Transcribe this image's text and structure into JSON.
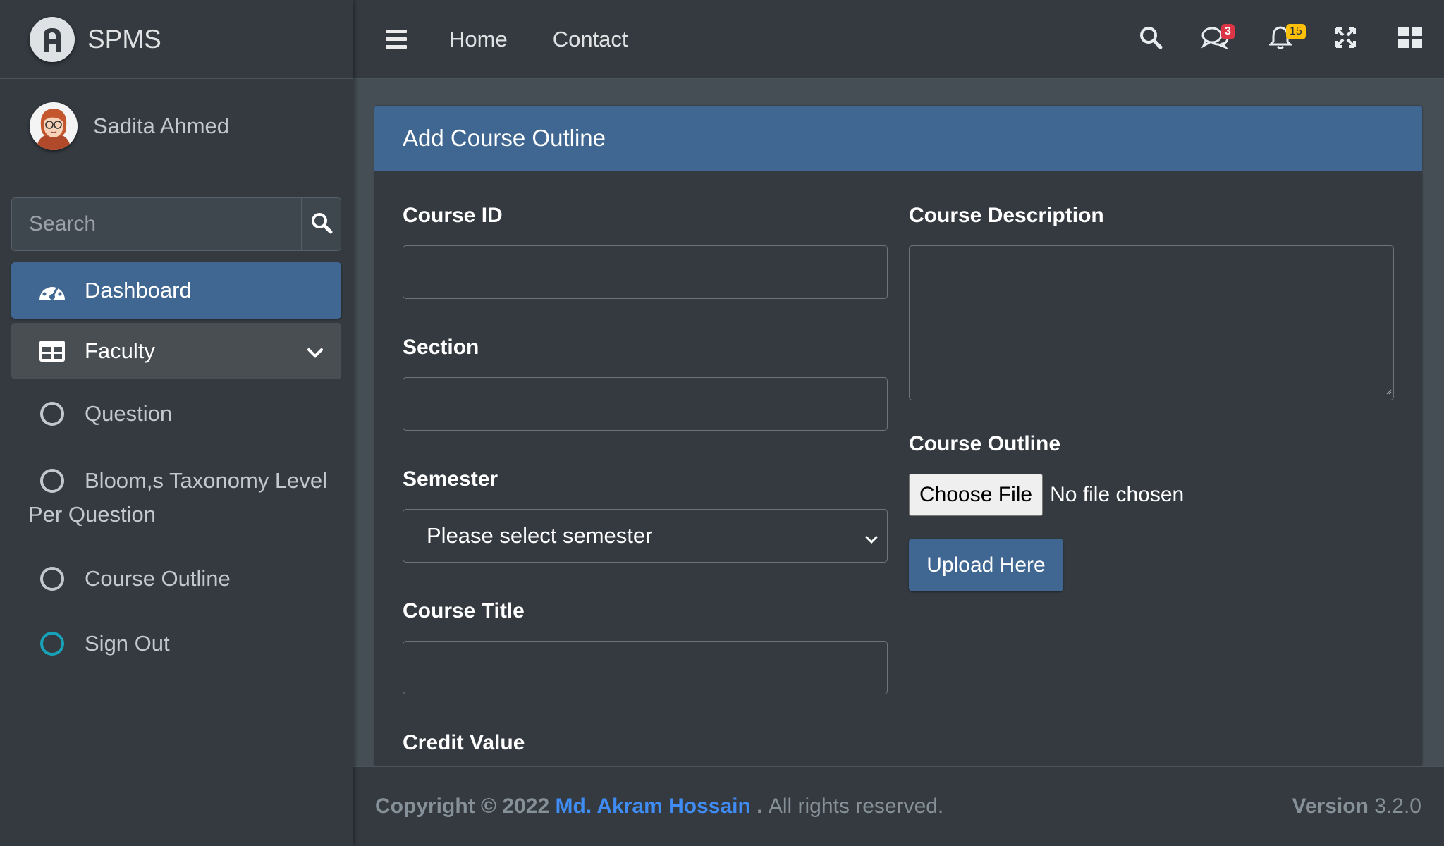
{
  "brand": {
    "name": "SPMS",
    "logo_icon": "app-logo-icon"
  },
  "user": {
    "name": "Sadita Ahmed"
  },
  "sidebar_search": {
    "placeholder": "Search",
    "icon": "search-icon"
  },
  "nav": {
    "dashboard": "Dashboard",
    "faculty": "Faculty",
    "question": "Question",
    "blooms_line1": "Bloom,s Taxonomy Level",
    "blooms_line2": "Per Question",
    "course_outline": "Course Outline",
    "sign_out": "Sign Out"
  },
  "topbar": {
    "home": "Home",
    "contact": "Contact",
    "messages_count": "3",
    "notifications_count": "15"
  },
  "card": {
    "title": "Add Course Outline",
    "course_id_label": "Course ID",
    "section_label": "Section",
    "semester_label": "Semester",
    "semester_value": "Please select semester",
    "course_title_label": "Course Title",
    "credit_value_label": "Credit Value",
    "course_description_label": "Course Description",
    "course_outline_label": "Course Outline",
    "choose_file": "Choose File",
    "file_status": "No file chosen",
    "upload_button": "Upload Here"
  },
  "footer": {
    "copyright": "Copyright © 2022",
    "author": "Md. Akram Hossain",
    "period": ".",
    "rights": "All rights reserved.",
    "version_label": "Version",
    "version_number": "3.2.0"
  },
  "colors": {
    "sidebar_bg": "#343a40",
    "content_bg": "#454d55",
    "primary": "#3f6791",
    "link": "#3f8cf5",
    "badge_red": "#dc3545",
    "badge_yellow": "#ffc107",
    "sign_out_icon": "#17a2b8"
  }
}
